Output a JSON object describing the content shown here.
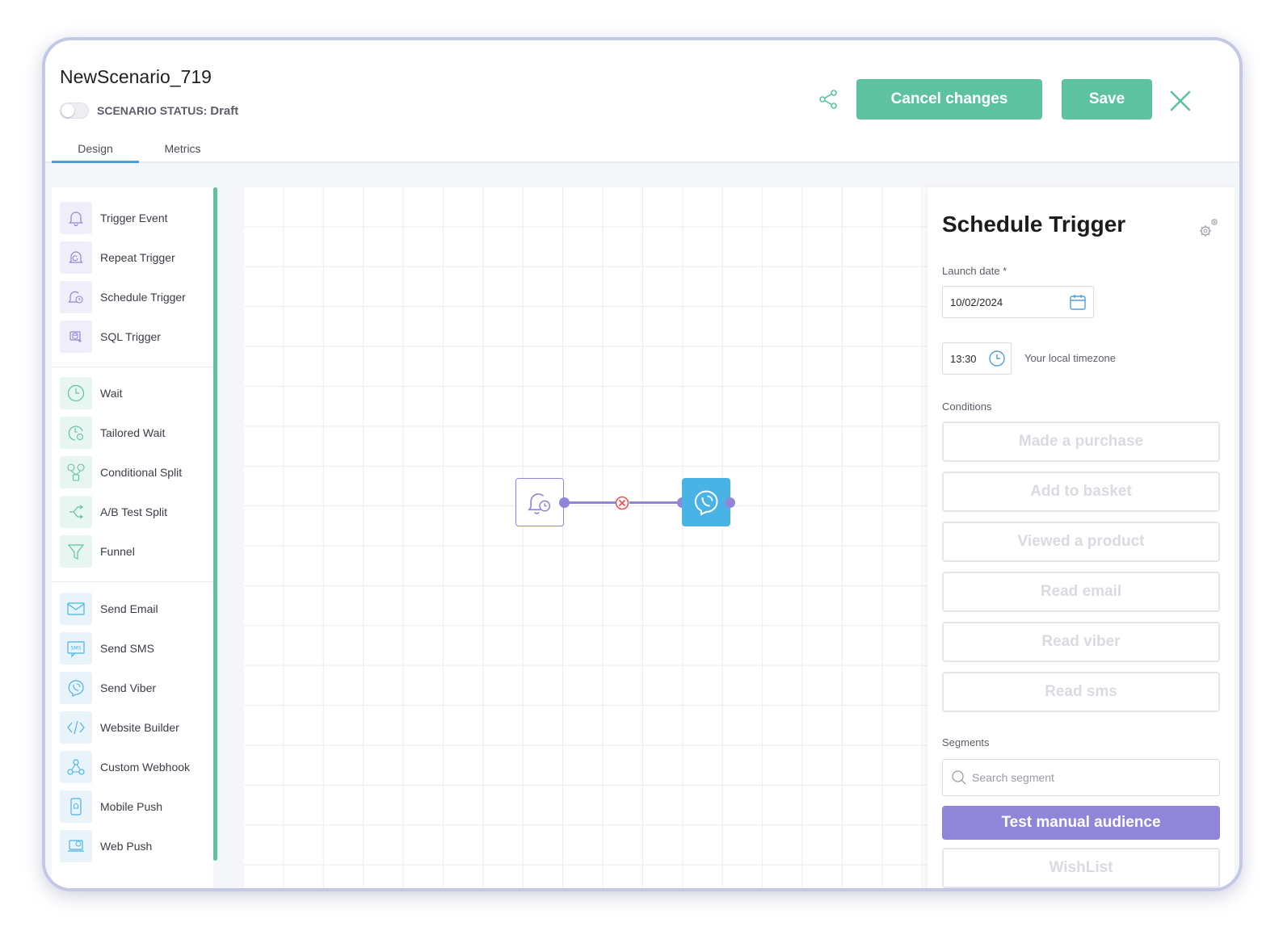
{
  "header": {
    "title": "NewScenario_719",
    "status_label": "SCENARIO STATUS:",
    "status_value": "Draft",
    "tabs": [
      {
        "label": "Design"
      },
      {
        "label": "Metrics"
      }
    ],
    "cancel_label": "Cancel changes",
    "save_label": "Save",
    "icons": {
      "share": "share-icon",
      "close": "close-icon"
    },
    "accent_color": "#5ec2a1"
  },
  "sidebar": {
    "items": [
      {
        "label": "Trigger Event",
        "icon": "bell-icon"
      },
      {
        "label": "Repeat Trigger",
        "icon": "bell-repeat-icon"
      },
      {
        "label": "Schedule Trigger",
        "icon": "bell-clock-icon"
      },
      {
        "label": "SQL Trigger",
        "icon": "database-bell-icon"
      },
      {
        "label": "Wait",
        "icon": "clock-icon"
      },
      {
        "label": "Tailored Wait",
        "icon": "tailored-clock-icon"
      },
      {
        "label": "Conditional Split",
        "icon": "split-icon"
      },
      {
        "label": "A/B Test Split",
        "icon": "ab-split-icon"
      },
      {
        "label": "Funnel",
        "icon": "funnel-icon"
      },
      {
        "label": "Send Email",
        "icon": "envelope-icon"
      },
      {
        "label": "Send SMS",
        "icon": "sms-icon"
      },
      {
        "label": "Send Viber",
        "icon": "viber-icon"
      },
      {
        "label": "Website Builder",
        "icon": "code-icon"
      },
      {
        "label": "Custom Webhook",
        "icon": "webhook-icon"
      },
      {
        "label": "Mobile Push",
        "icon": "mobile-push-icon"
      },
      {
        "label": "Web Push",
        "icon": "web-push-icon"
      }
    ]
  },
  "canvas": {
    "nodes": [
      {
        "type": "Schedule Trigger",
        "icon": "bell-clock-icon"
      },
      {
        "type": "Send Viber",
        "icon": "viber-icon"
      }
    ],
    "link_delete_icon": "remove-link-icon"
  },
  "panel": {
    "title": "Schedule Trigger",
    "launch_date_label": "Launch date *",
    "launch_date_value": "10/02/2024",
    "time_value": "13:30",
    "timezone_note": "Your local timezone",
    "conditions_label": "Conditions",
    "conditions": [
      "Made a purchase",
      "Add to basket",
      "Viewed a product",
      "Read email",
      "Read viber",
      "Read sms"
    ],
    "segments_label": "Segments",
    "search_placeholder": "Search segment",
    "segments": [
      "Test manual audience",
      "WishList"
    ],
    "selected_segment_color": "#8f86d9"
  }
}
